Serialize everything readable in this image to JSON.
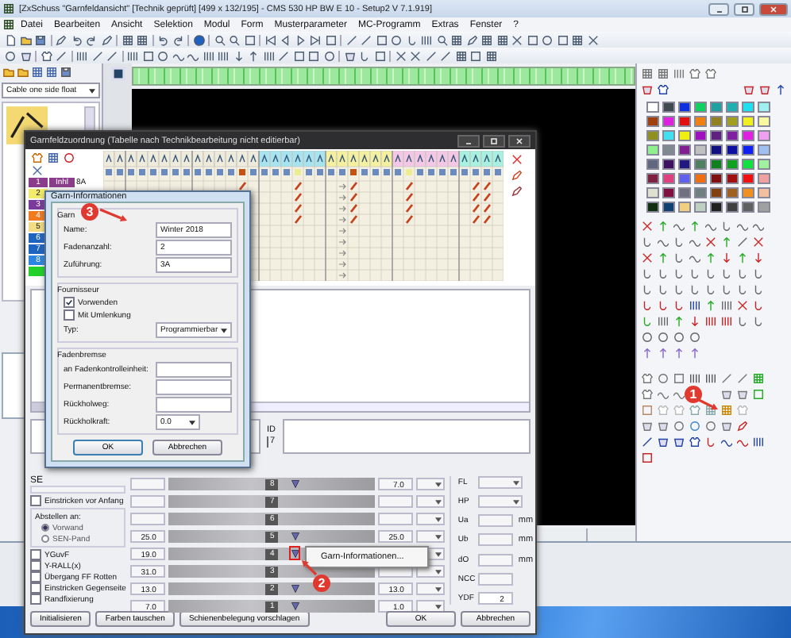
{
  "window": {
    "title": "[ZxSchuss \"Garnfeldansicht\" [Technik geprüft] [499 x 132/195] - CMS 530 HP BW E 10 - Setup2    V 7.1.919]"
  },
  "menu": [
    "Datei",
    "Bearbeiten",
    "Ansicht",
    "Selektion",
    "Modul",
    "Form",
    "Musterparameter",
    "MC-Programm",
    "Extras",
    "Fenster",
    "?"
  ],
  "left_panel": {
    "dropdown": "Cable one side float"
  },
  "palette": [
    {
      "color": "#ffffff"
    },
    {
      "color": "#404850"
    },
    {
      "color": "#1030e0"
    },
    {
      "color": "#10d060"
    },
    {
      "color": "#20a0a0"
    },
    {
      "color": "#20b0b0"
    },
    {
      "color": "#20e0f0"
    },
    {
      "color": "#a0f0f0"
    },
    {
      "color": "#a04010"
    },
    {
      "color": "#e020e0"
    },
    {
      "color": "#e01010"
    },
    {
      "color": "#f08010"
    },
    {
      "color": "#908020"
    },
    {
      "color": "#a0a020"
    },
    {
      "color": "#f0f020"
    },
    {
      "color": "#f8f8a0"
    },
    {
      "color": "#909020"
    },
    {
      "color": "#40e0f0"
    },
    {
      "color": "#f0f010"
    },
    {
      "color": "#a010c0"
    },
    {
      "color": "#602080"
    },
    {
      "color": "#8020a0"
    },
    {
      "color": "#e020e0"
    },
    {
      "color": "#f0a0f0"
    },
    {
      "color": "#90f090"
    },
    {
      "color": "#808890"
    },
    {
      "color": "#802090"
    },
    {
      "color": "#c0c0c0"
    },
    {
      "color": "#101080"
    },
    {
      "color": "#1010a0"
    },
    {
      "color": "#1020f0"
    },
    {
      "color": "#a0c0f0"
    },
    {
      "color": "#606880"
    },
    {
      "color": "#401060"
    },
    {
      "color": "#201880"
    },
    {
      "color": "#508060"
    },
    {
      "color": "#108020"
    },
    {
      "color": "#10a020"
    },
    {
      "color": "#10e040"
    },
    {
      "color": "#a0f0a0"
    },
    {
      "color": "#802040"
    },
    {
      "color": "#e04080"
    },
    {
      "color": "#6060f0"
    },
    {
      "color": "#f07010"
    },
    {
      "color": "#801010"
    },
    {
      "color": "#a01010"
    },
    {
      "color": "#f01010"
    },
    {
      "color": "#f0a0a0"
    },
    {
      "color": "#e0e0d0"
    },
    {
      "color": "#801040"
    },
    {
      "color": "#707080"
    },
    {
      "color": "#708080"
    },
    {
      "color": "#804010"
    },
    {
      "color": "#a06020"
    },
    {
      "color": "#f09020"
    },
    {
      "color": "#f0c0a0"
    },
    {
      "color": "#103010"
    },
    {
      "color": "#104070"
    },
    {
      "color": "#f0d080"
    },
    {
      "color": "#c0d0c0"
    },
    {
      "color": "#202020"
    },
    {
      "color": "#404040"
    },
    {
      "color": "#606060"
    },
    {
      "color": "#a0a0a0"
    }
  ],
  "yarn_dialog": {
    "title": "Garnfeldzuordnung (Tabelle nach Technikbearbeitung nicht editierbar)",
    "yarn_rows": [
      {
        "number": "1",
        "color": "#8b3d8b",
        "yarn": "Inhl",
        "feeder": "8A"
      },
      {
        "number": "2",
        "color": "#f2ec6c"
      },
      {
        "number": "3",
        "color": "#7a3a9a"
      },
      {
        "number": "4",
        "color": "#f07a20"
      },
      {
        "number": "5",
        "color": "#f3de86"
      },
      {
        "number": "6",
        "color": "#1d64c0"
      },
      {
        "number": "7",
        "color": "#1d64c0"
      },
      {
        "number": "8",
        "color": "#2a86e0"
      },
      {
        "color": "#22d22a"
      }
    ],
    "id_label": "ID",
    "id_value": "7",
    "sen_label": "SE",
    "options_top": [
      {
        "label": "Einstricken vor Anfang",
        "checked": false
      }
    ],
    "stop_group": {
      "label": "Abstellen an:",
      "options": [
        {
          "label": "Vorwand",
          "selected": true
        },
        {
          "label": "SEN-Pand",
          "selected": false
        }
      ]
    },
    "options": [
      {
        "label": "YGuvF",
        "checked": false
      },
      {
        "label": "Y-RALL(x)",
        "checked": false
      },
      {
        "label": "Übergang FF Rotten",
        "checked": false
      },
      {
        "label": "Einstricken Gegenseite",
        "checked": false
      },
      {
        "label": "Randfixierung",
        "checked": false
      }
    ],
    "rails": [
      {
        "number": "8",
        "right_value": "7.0",
        "carrier": true,
        "highlighted": false
      },
      {
        "number": "7",
        "carrier": false,
        "highlighted": false
      },
      {
        "number": "6",
        "carrier": false,
        "highlighted": false
      },
      {
        "number": "5",
        "left_value": "25.0",
        "right_value": "25.0",
        "carrier": true,
        "highlighted": false
      },
      {
        "number": "4",
        "left_value": "19.0",
        "carrier": true,
        "highlighted": true
      },
      {
        "number": "3",
        "left_value": "31.0",
        "carrier": false,
        "highlighted": false
      },
      {
        "number": "2",
        "left_value": "13.0",
        "right_value": "13.0",
        "carrier": true,
        "highlighted": false
      },
      {
        "number": "1",
        "left_value": "7.0",
        "right_value": "1.0",
        "carrier": true,
        "highlighted": false
      }
    ],
    "settings": [
      {
        "label": "FL",
        "kind": "combo"
      },
      {
        "label": "HP",
        "kind": "combo"
      },
      {
        "label": "Ua",
        "kind": "spin",
        "unit": "mm"
      },
      {
        "label": "Ub",
        "kind": "spin",
        "unit": "mm"
      },
      {
        "label": "dO",
        "kind": "spin",
        "unit": "mm"
      },
      {
        "label": "NCC",
        "kind": "spin"
      }
    ],
    "ydf": {
      "label": "YDF",
      "value": "2"
    },
    "buttons": [
      "Initialisieren",
      "Farben tauschen",
      "Schienenbelegung vorschlagen"
    ],
    "ok": "OK",
    "cancel": "Abbrechen"
  },
  "yarn_info_dialog": {
    "title": "Garn-Informationen",
    "yarn_group": "Garn",
    "fields": [
      {
        "label": "Name:",
        "value": "Winter 2018"
      },
      {
        "label": "Fadenanzahl:",
        "value": "2"
      },
      {
        "label": "Zuführung:",
        "value": "3A"
      }
    ],
    "supplier_group": "Fournisseur",
    "checks": [
      {
        "label": "Vorwenden",
        "checked": true
      },
      {
        "label": "Mit Umlenkung",
        "checked": false
      }
    ],
    "type": {
      "label": "Typ:",
      "value": "Programmierbar"
    },
    "brake_group": "Fadenbremse",
    "brake_fields": [
      {
        "label": "an Fadenkontrolleinheit:"
      },
      {
        "label": "Permanentbremse:"
      },
      {
        "label": "Rückholweg:"
      }
    ],
    "return_force": {
      "label": "Rückholkraft:",
      "value": "0.0"
    },
    "ok": "OK",
    "cancel": "Abbrechen"
  },
  "context_menu": [
    "Garn-Informationen..."
  ],
  "annotations": [
    {
      "label": "3"
    },
    {
      "label": "2"
    },
    {
      "label": "1"
    }
  ]
}
